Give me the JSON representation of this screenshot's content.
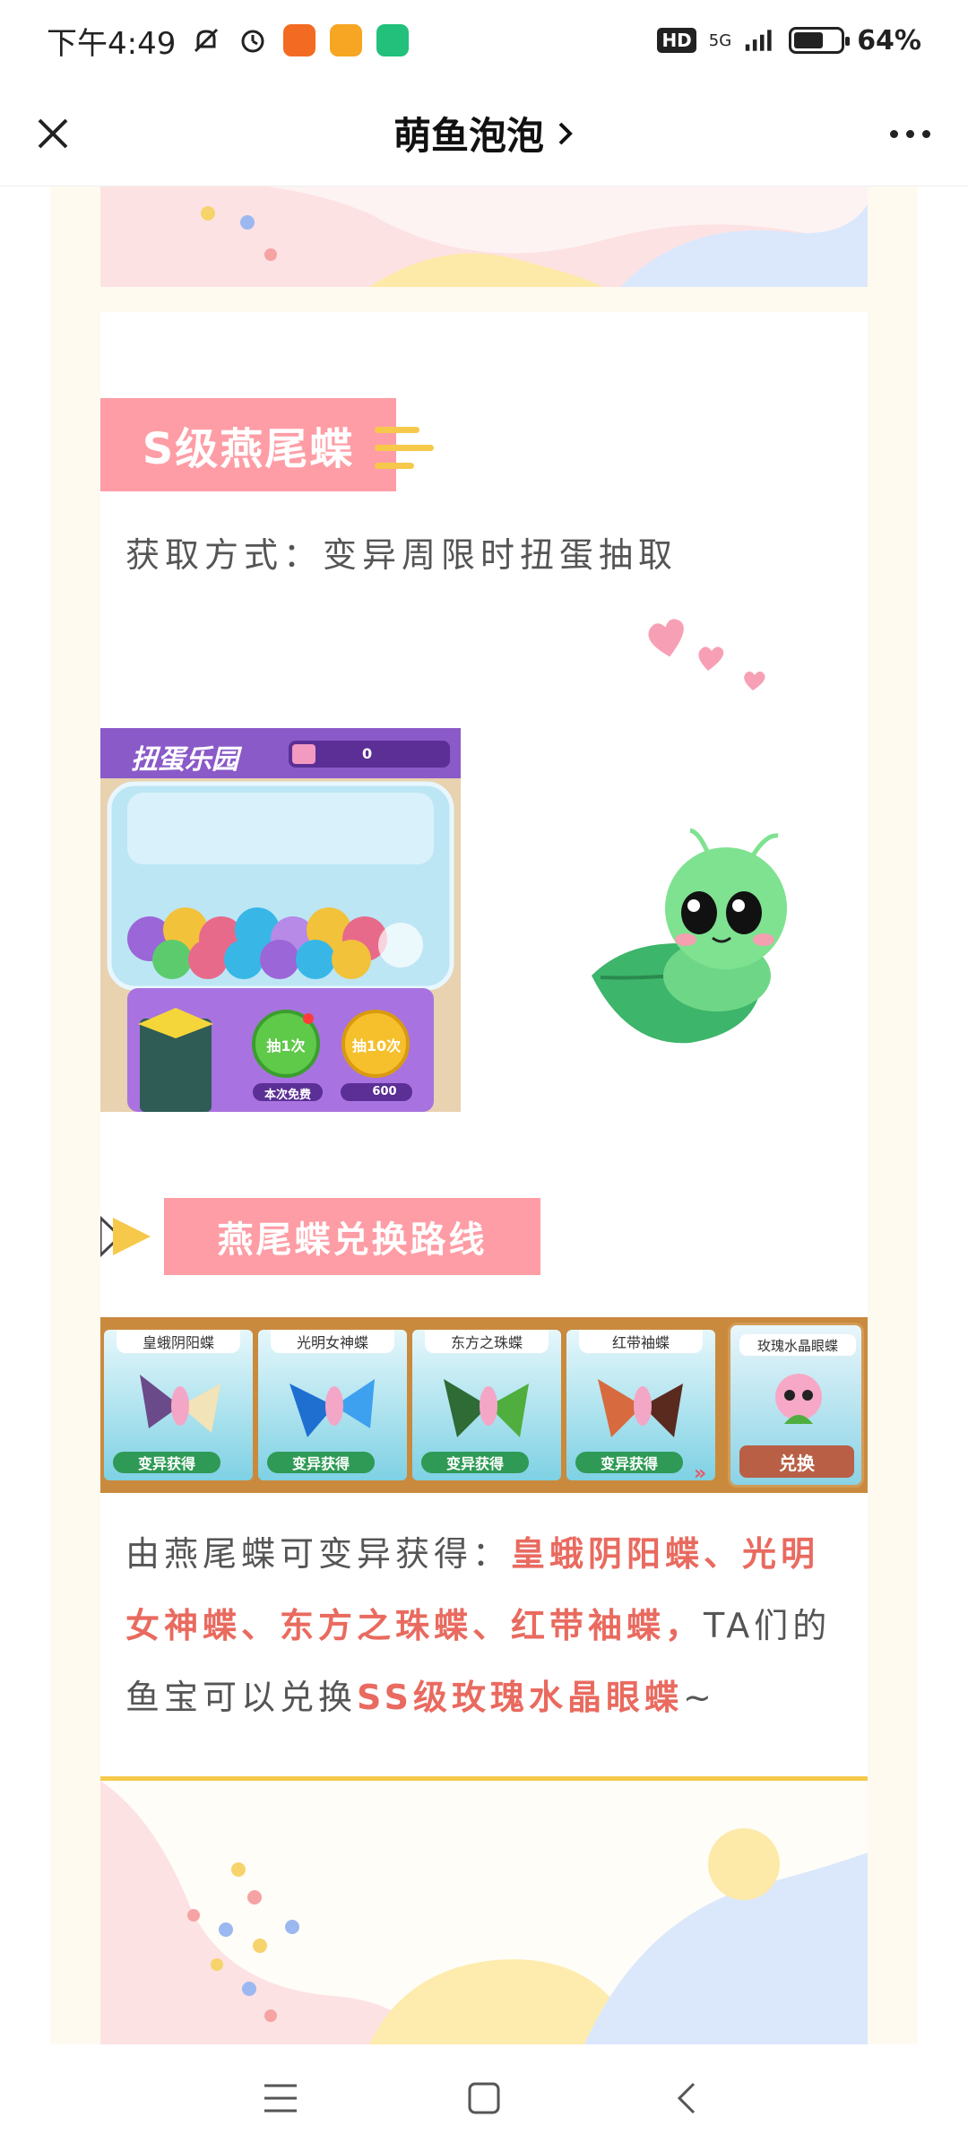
{
  "status_bar": {
    "time": "下午4:49",
    "network": "5G",
    "hd": "HD",
    "battery": "64%",
    "battery_level": 0.64
  },
  "title_bar": {
    "title": "萌鱼泡泡",
    "close_icon": "close-icon",
    "more_icon": "more-icon"
  },
  "section": {
    "badge_title": "S级燕尾蝶",
    "method": "获取方式：变异周限时扭蛋抽取",
    "gacha": {
      "title": "扭蛋乐园",
      "counter": "0",
      "draw_once": "抽1次",
      "draw_ten": "抽10次",
      "free_label": "本次免费",
      "price": "600"
    },
    "route_title": "燕尾蝶兑换路线",
    "route": {
      "items": [
        {
          "name": "皇蛾阴阳蝶",
          "get": "变异获得"
        },
        {
          "name": "光明女神蝶",
          "get": "变异获得"
        },
        {
          "name": "东方之珠蝶",
          "get": "变异获得"
        },
        {
          "name": "红带袖蝶",
          "get": "变异获得"
        }
      ],
      "exchange_name": "玫瑰水晶眼蝶",
      "exchange_button": "兑换"
    },
    "description": {
      "part1": "由燕尾蝶可变异获得：",
      "highlight1": "皇蛾阴阳蝶、光明女神蝶、东方之珠蝶、红带袖蝶，",
      "part2": "TA们的鱼宝可以兑换",
      "highlight2": "SS级玫瑰水晶眼蝶",
      "part3": "~"
    }
  },
  "colors": {
    "badge_pink": "#fe9da5",
    "accent_yellow": "#f6c94b",
    "highlight_red": "#e96a5f"
  }
}
